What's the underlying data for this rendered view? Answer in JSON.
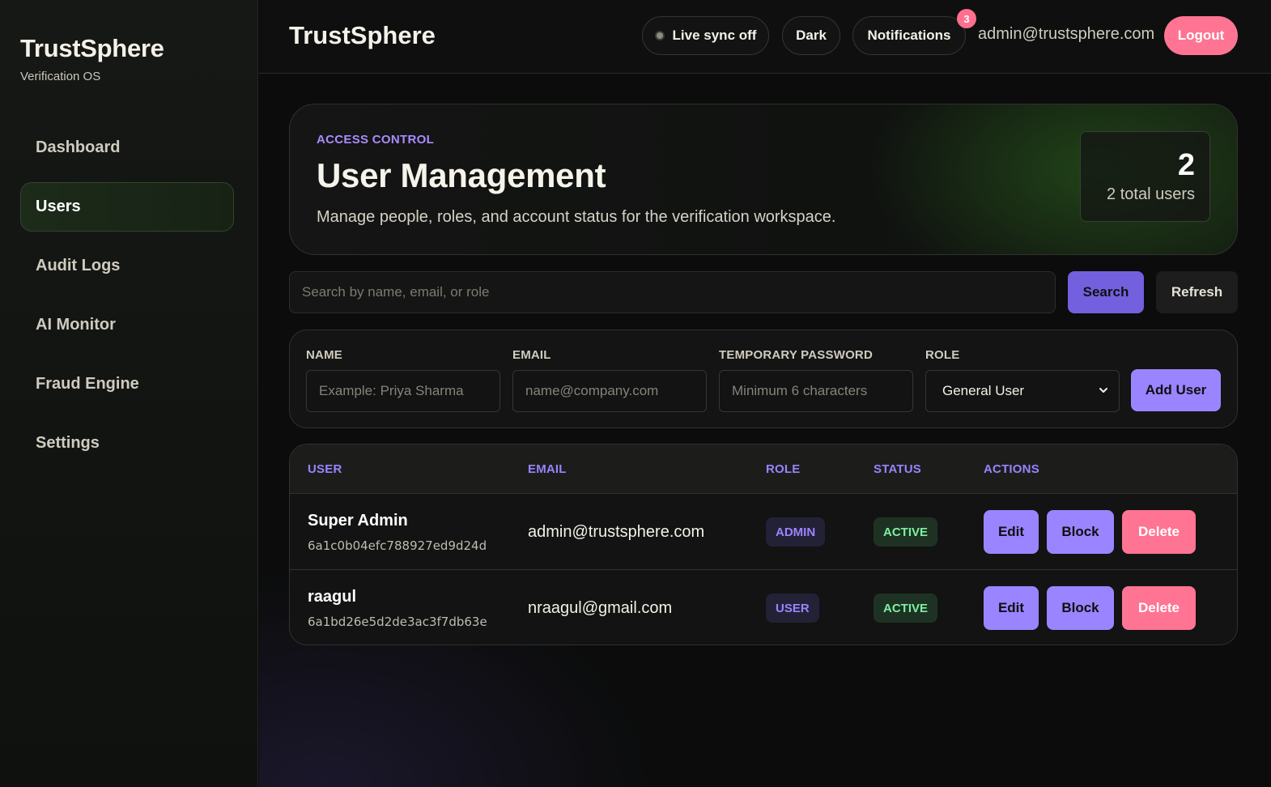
{
  "sidebar": {
    "brand": "TrustSphere",
    "subtitle": "Verification OS",
    "items": [
      {
        "label": "Dashboard"
      },
      {
        "label": "Users"
      },
      {
        "label": "Audit Logs"
      },
      {
        "label": "AI Monitor"
      },
      {
        "label": "Fraud Engine"
      },
      {
        "label": "Settings"
      }
    ],
    "active": "Users"
  },
  "topbar": {
    "title": "TrustSphere",
    "live_sync": "Live sync off",
    "theme": "Dark",
    "notifications": "Notifications",
    "notification_count": "3",
    "user_email": "admin@trustsphere.com",
    "logout": "Logout"
  },
  "hero": {
    "eyebrow": "ACCESS CONTROL",
    "title": "User Management",
    "description": "Manage people, roles, and account status for the verification workspace.",
    "stat_value": "2",
    "stat_label": "2 total users"
  },
  "search": {
    "placeholder": "Search by name, email, or role",
    "search_label": "Search",
    "refresh_label": "Refresh"
  },
  "form": {
    "name_label": "NAME",
    "name_placeholder": "Example: Priya Sharma",
    "email_label": "EMAIL",
    "email_placeholder": "name@company.com",
    "password_label": "TEMPORARY PASSWORD",
    "password_placeholder": "Minimum 6 characters",
    "role_label": "ROLE",
    "role_value": "General User",
    "add_label": "Add User"
  },
  "table": {
    "headers": [
      "USER",
      "EMAIL",
      "ROLE",
      "STATUS",
      "ACTIONS"
    ],
    "rows": [
      {
        "name": "Super Admin",
        "id": "6a1c0b04efc788927ed9d24d",
        "email": "admin@trustsphere.com",
        "role": "ADMIN",
        "status": "ACTIVE"
      },
      {
        "name": "raagul",
        "id": "6a1bd26e5d2de3ac3f7db63e",
        "email": "nraagul@gmail.com",
        "role": "USER",
        "status": "ACTIVE"
      }
    ],
    "actions": {
      "edit": "Edit",
      "block": "Block",
      "delete": "Delete"
    }
  },
  "colors": {
    "accent": "#9b84ff",
    "danger": "#ff7492",
    "success": "#7ef0a0",
    "background": "#0b0c0b"
  }
}
